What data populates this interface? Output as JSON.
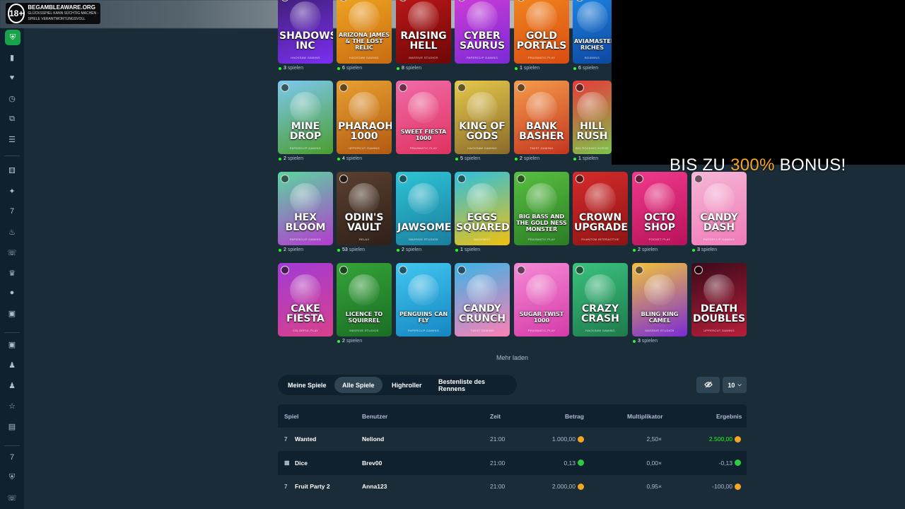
{
  "age_badge": {
    "age": "18+",
    "line1": "BEGAMBLEAWARE.ORG",
    "line2": "GLÜCKSSPIEL KANN SÜCHTIG MACHEN · SPIELE VERANTWORTUNGSVOLL"
  },
  "bonus": {
    "prefix": "BIS ZU ",
    "amount": "300%",
    "suffix": " BONUS!"
  },
  "colors": {
    "accent": "#f6a623",
    "online_dot": "#1fff20",
    "win": "#1fff20",
    "panel": "#0f212e",
    "bg": "#1a2c38"
  },
  "sidebar_icons": [
    "shield-icon",
    "bookmark-icon",
    "heart-icon",
    "clock-icon",
    "copy-icon",
    "list-icon",
    "dice-icon",
    "sparkle-icon",
    "sevens-icon",
    "fire-icon",
    "headphones-icon",
    "crown-icon",
    "lock-icon",
    "gift-icon",
    "gift-box-icon",
    "dealer-icon",
    "users-icon",
    "trophy-icon",
    "document-icon",
    "sevens-icon",
    "shield-check-icon",
    "headset-icon"
  ],
  "games": [
    {
      "title": "SHADOWS INC",
      "provider": "HACKSAW GAMING",
      "players": "3",
      "colors": [
        "#3b1e6e",
        "#7b2ff2"
      ]
    },
    {
      "title": "ARIZONA JAMES & THE LOST RELIC",
      "provider": "HACKSAW GAMING",
      "players": "6",
      "colors": [
        "#f2a922",
        "#c86b12"
      ]
    },
    {
      "title": "RAISING HELL",
      "provider": "MASSIVE STUDIOS",
      "players": "8",
      "colors": [
        "#c21818",
        "#6d0707"
      ]
    },
    {
      "title": "CYBER SAURUS",
      "provider": "PAPERCLIP GAMING",
      "players": "",
      "colors": [
        "#d43dd6",
        "#7a2ad6"
      ]
    },
    {
      "title": "GOLD PORTALS",
      "provider": "PRAGMATIC PLAY",
      "players": "1",
      "colors": [
        "#f28a1e",
        "#d94b13"
      ]
    },
    {
      "title": "AVIAMASTERS RICHES",
      "provider": "BGAMING",
      "players": "6",
      "colors": [
        "#1e88e5",
        "#0d47a1"
      ]
    },
    {
      "title": "MINE DROP",
      "provider": "PAPERCLIP GAMING",
      "players": "2",
      "colors": [
        "#7ec8f0",
        "#4a9e2d"
      ]
    },
    {
      "title": "PHARAOH 1000",
      "provider": "UPPERCUT GAMING",
      "players": "4",
      "colors": [
        "#e8a030",
        "#b25a12"
      ]
    },
    {
      "title": "SWEET FIESTA 1000",
      "provider": "PRAGMATIC PLAY",
      "players": "",
      "colors": [
        "#f06ba8",
        "#e0325f"
      ]
    },
    {
      "title": "KING OF GODS",
      "provider": "HACKSAW GAMING",
      "players": "5",
      "colors": [
        "#e5c84a",
        "#8a6a2a"
      ]
    },
    {
      "title": "BANK BASHER",
      "provider": "TWIST GAMING",
      "players": "2",
      "colors": [
        "#f59b4a",
        "#c4361f"
      ]
    },
    {
      "title": "HILL RUSH",
      "provider": "BIG ROCKING HORSE",
      "players": "1",
      "colors": [
        "#e83a3a",
        "#7cc34a"
      ]
    },
    {
      "title": "HEX BLOOM",
      "provider": "PAPERCLIP GAMING",
      "players": "2",
      "colors": [
        "#5ad6a0",
        "#b43ad0"
      ]
    },
    {
      "title": "ODIN'S VAULT",
      "provider": "RELAX",
      "players": "53",
      "colors": [
        "#5a4030",
        "#2e2018"
      ]
    },
    {
      "title": "JAWSOME",
      "provider": "MASSIVE STUDIOS",
      "players": "2",
      "colors": [
        "#2ec4d6",
        "#1a7e9e"
      ]
    },
    {
      "title": "EGGS SQUARED",
      "provider": "BACKSEAT",
      "players": "1",
      "colors": [
        "#2bc0e0",
        "#f2c10e"
      ]
    },
    {
      "title": "BIG BASS AND THE GOLD NESS MONSTER",
      "provider": "PRAGMATIC PLAY",
      "players": "",
      "colors": [
        "#58c040",
        "#2a7d25"
      ]
    },
    {
      "title": "CROWN UPGRADE",
      "provider": "PHANTOM INTERACTIVE",
      "players": "",
      "colors": [
        "#d62b2b",
        "#8e1414"
      ]
    },
    {
      "title": "OCTO SHOP",
      "provider": "POCKET PLAY",
      "players": "2",
      "colors": [
        "#f03a8a",
        "#b8125a"
      ]
    },
    {
      "title": "CANDY DASH",
      "provider": "PAPERCLIP GAMING",
      "players": "3",
      "colors": [
        "#f5b7d6",
        "#f07ab8"
      ]
    },
    {
      "title": "CAKE FIESTA",
      "provider": "COLORFUL PLAY",
      "players": "",
      "colors": [
        "#a23ad6",
        "#d9418a"
      ]
    },
    {
      "title": "LICENCE TO SQUIRREL",
      "provider": "MASSIVE STUDIOS",
      "players": "2",
      "colors": [
        "#35a338",
        "#1b6e25"
      ]
    },
    {
      "title": "PENGUINS CAN FLY",
      "provider": "PAPERCLIP GAMING",
      "players": "",
      "colors": [
        "#42c7f0",
        "#1586c2"
      ]
    },
    {
      "title": "CANDY CRUNCH",
      "provider": "TWIST GAMING",
      "players": "",
      "colors": [
        "#3ab4e6",
        "#ff7fb5"
      ]
    },
    {
      "title": "SUGAR TWIST 1000",
      "provider": "PRAGMATIC PLAY",
      "players": "",
      "colors": [
        "#f58ad6",
        "#d53aa8"
      ]
    },
    {
      "title": "CRAZY CRASH",
      "provider": "HACKSAW GAMING",
      "players": "",
      "colors": [
        "#3ac27e",
        "#1e7a4c"
      ]
    },
    {
      "title": "BLING KING CAMEL",
      "provider": "MASSIVE STUDIOS",
      "players": "3",
      "colors": [
        "#f2c23a",
        "#7a2ad6"
      ]
    },
    {
      "title": "DEATH DOUBLES",
      "provider": "UPPERCUT GAMING",
      "players": "",
      "colors": [
        "#3a0a1a",
        "#b81e3a"
      ]
    }
  ],
  "players_suffix": "spielen",
  "load_more": "Mehr laden",
  "tabs": [
    {
      "label": "Meine Spiele",
      "active": false
    },
    {
      "label": "Alle Spiele",
      "active": true
    },
    {
      "label": "Highroller",
      "active": false
    },
    {
      "label": "Bestenliste des Rennens",
      "active": false
    }
  ],
  "filter_icon": "eye-off-icon",
  "page_size": {
    "value": "10",
    "icon": "chevron-down-icon"
  },
  "table": {
    "headers": [
      "Spiel",
      "Benutzer",
      "Zeit",
      "Betrag",
      "Multiplikator",
      "Ergebnis"
    ],
    "rows": [
      {
        "game": "Wanted",
        "icon": "sevens-icon",
        "user": "Neliond",
        "time": "21:00",
        "amount": "1.000,00",
        "amount_coin": "gold",
        "multiplier": "2,50×",
        "result": "2.500,00",
        "result_coin": "gold",
        "win": true
      },
      {
        "game": "Dice",
        "icon": "dice-icon",
        "user": "Brev00",
        "time": "21:00",
        "amount": "0,13",
        "amount_coin": "green",
        "multiplier": "0,00×",
        "result": "-0,13",
        "result_coin": "green",
        "win": false
      },
      {
        "game": "Fruit Party 2",
        "icon": "sevens-icon",
        "user": "Anna123",
        "time": "21:00",
        "amount": "2.000,00",
        "amount_coin": "gold",
        "multiplier": "0,95×",
        "result": "-100,00",
        "result_coin": "gold",
        "win": false
      }
    ]
  }
}
